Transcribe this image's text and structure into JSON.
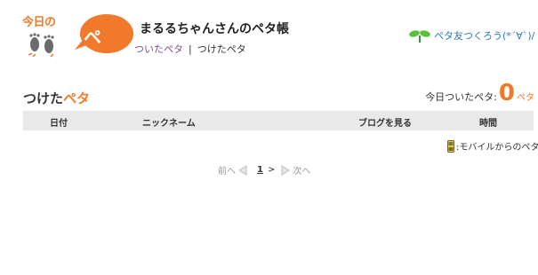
{
  "logo": {
    "kyou_text": "今日の",
    "peta_text": "ペタ"
  },
  "header": {
    "title": "まるるちゃんさんのペタ帳",
    "tabs": {
      "received": "ついたペタ",
      "separator": "|",
      "given": "つけたペタ"
    },
    "friend_link": "ペタ友つくろう(*´∀`)/"
  },
  "section": {
    "title_prefix": "つけた",
    "title_peta": "ペタ",
    "today_label": "今日ついたペタ:",
    "today_count": "0",
    "today_unit": "ペタ"
  },
  "table": {
    "columns": [
      "日付",
      "ニックネーム",
      "ブログを見る",
      "時間"
    ]
  },
  "mobile_note": ":モバイルからのペタ",
  "pager": {
    "prev": "前へ",
    "current": "1",
    "gt": ">",
    "next": "次へ"
  },
  "colors": {
    "accent": "#f07a2a",
    "tab_active": "#7b4fa3",
    "link": "#2a7ac0",
    "table_header_bg": "#e9e9e9"
  }
}
